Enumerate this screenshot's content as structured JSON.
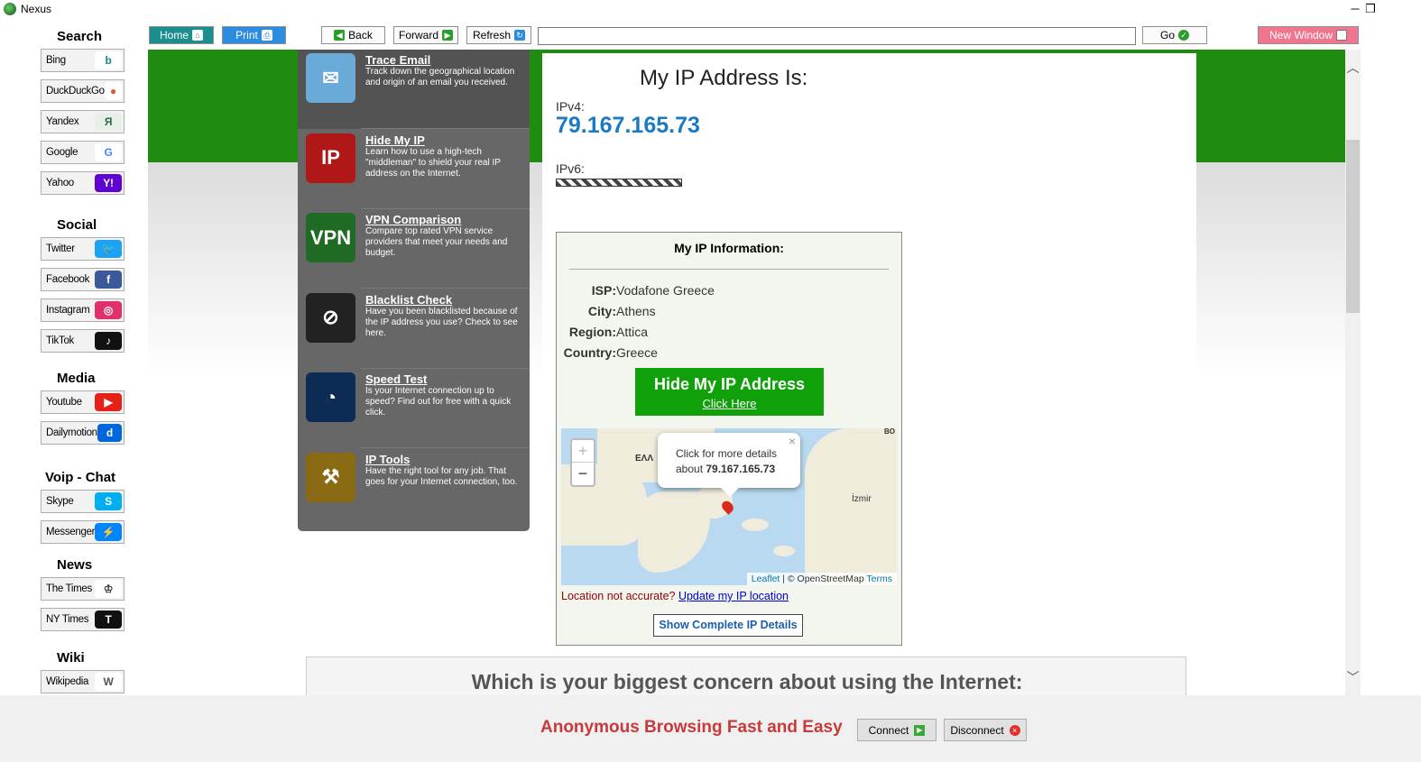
{
  "window": {
    "title": "Nexus",
    "restore_glyph": "❐"
  },
  "sidebar": {
    "categories": [
      {
        "title": "Search",
        "items": [
          {
            "label": "Bing",
            "icon": "bing-icon",
            "glyph": "b",
            "color": "#0e8a8a",
            "bg": "#ffffff"
          },
          {
            "label": "DuckDuckGo",
            "icon": "duckduckgo-icon",
            "glyph": "●",
            "color": "#de5833",
            "bg": "#ffffff"
          },
          {
            "label": "Yandex",
            "icon": "yandex-icon",
            "glyph": "Я",
            "color": "#2a6b4a",
            "bg": "#e8efe8"
          },
          {
            "label": "Google",
            "icon": "google-icon",
            "glyph": "G",
            "color": "#4285f4",
            "bg": "#ffffff"
          },
          {
            "label": "Yahoo",
            "icon": "yahoo-icon",
            "glyph": "Y!",
            "color": "#ffffff",
            "bg": "#5f01d1"
          }
        ]
      },
      {
        "title": "Social",
        "items": [
          {
            "label": "Twitter",
            "icon": "twitter-icon",
            "glyph": "🐦",
            "color": "#ffffff",
            "bg": "#1da1f2"
          },
          {
            "label": "Facebook",
            "icon": "facebook-icon",
            "glyph": "f",
            "color": "#ffffff",
            "bg": "#3b5998"
          },
          {
            "label": "Instagram",
            "icon": "instagram-icon",
            "glyph": "◎",
            "color": "#ffffff",
            "bg": "#e1306c"
          },
          {
            "label": "TikTok",
            "icon": "tiktok-icon",
            "glyph": "♪",
            "color": "#ffffff",
            "bg": "#111111"
          }
        ]
      },
      {
        "title": "Media",
        "items": [
          {
            "label": "Youtube",
            "icon": "youtube-icon",
            "glyph": "▶",
            "color": "#ffffff",
            "bg": "#e62117"
          },
          {
            "label": "Dailymotion",
            "icon": "dailymotion-icon",
            "glyph": "d",
            "color": "#ffffff",
            "bg": "#0066dc"
          }
        ]
      },
      {
        "title": "Voip - Chat",
        "items": [
          {
            "label": "Skype",
            "icon": "skype-icon",
            "glyph": "S",
            "color": "#ffffff",
            "bg": "#00aff0"
          },
          {
            "label": "Messenger",
            "icon": "messenger-icon",
            "glyph": "⚡",
            "color": "#ffffff",
            "bg": "#0084ff"
          }
        ]
      },
      {
        "title": "News",
        "items": [
          {
            "label": "The Times",
            "icon": "the-times-icon",
            "glyph": "♔",
            "color": "#333333",
            "bg": "#ffffff"
          },
          {
            "label": "NY Times",
            "icon": "ny-times-icon",
            "glyph": "T",
            "color": "#ffffff",
            "bg": "#111111"
          }
        ]
      },
      {
        "title": "Wiki",
        "items": [
          {
            "label": "Wikipedia",
            "icon": "wikipedia-icon",
            "glyph": "W",
            "color": "#555555",
            "bg": "#ffffff"
          }
        ]
      }
    ]
  },
  "toolbar": {
    "home_label": "Home",
    "print_label": "Print",
    "back_label": "Back",
    "forward_label": "Forward",
    "refresh_label": "Refresh",
    "url_value": "",
    "go_label": "Go",
    "new_window_label": "New Window"
  },
  "tools": [
    {
      "name": "Trace Email",
      "desc": "Track down the geographical location and origin of an email you received.",
      "icon": "trace-email-icon",
      "glyph": "✉",
      "bg": "#6aaad8"
    },
    {
      "name": "Hide My IP",
      "desc": "Learn how to use a high-tech \"middleman\" to shield your real IP address on the Internet.",
      "icon": "hide-my-ip-icon",
      "glyph": "IP",
      "bg": "#b01717"
    },
    {
      "name": "VPN Comparison",
      "desc": "Compare top rated VPN service providers that meet your needs and budget.",
      "icon": "vpn-comparison-icon",
      "glyph": "VPN",
      "bg": "#1f6b23"
    },
    {
      "name": "Blacklist Check",
      "desc": "Have you been blacklisted because of the IP address you use? Check to see here.",
      "icon": "blacklist-check-icon",
      "glyph": "⊘",
      "bg": "#222222"
    },
    {
      "name": "Speed Test",
      "desc": "Is your Internet connection up to speed? Find out for free with a quick click.",
      "icon": "speed-test-icon",
      "glyph": "◔",
      "bg": "#0d2c55"
    },
    {
      "name": "IP Tools",
      "desc": "Have the right tool for any job. That goes for your Internet connection, too.",
      "icon": "ip-tools-icon",
      "glyph": "⚒",
      "bg": "#8a6a12"
    }
  ],
  "ip": {
    "heading": "My IP Address Is:",
    "ipv4_label": "IPv4:",
    "ipv4_value": "79.167.165.73",
    "ipv6_label": "IPv6:"
  },
  "info": {
    "title": "My IP Information:",
    "rows": [
      {
        "key": "ISP:",
        "value": "Vodafone Greece"
      },
      {
        "key": "City:",
        "value": "Athens"
      },
      {
        "key": "Region:",
        "value": "Attica"
      },
      {
        "key": "Country:",
        "value": "Greece"
      }
    ],
    "hide_btn_title": "Hide My IP Address",
    "hide_btn_link": "Click Here",
    "map": {
      "zoom_in": "+",
      "zoom_out": "−",
      "popup_line1": "Click for more details",
      "popup_line2_prefix": "about ",
      "popup_ip": "79.167.165.73",
      "close": "×",
      "attr_leaflet": "Leaflet",
      "attr_osm": " | © OpenStreetMap ",
      "attr_terms": "Terms",
      "label_ellada": "ΕΛΛ",
      "label_izmir": "İzmir",
      "label_bo": "BO"
    },
    "location_question": "Location not accurate? ",
    "location_link": "Update my IP location",
    "details_btn": "Show Complete IP Details"
  },
  "poll": {
    "question": "Which is your biggest concern about using the Internet:"
  },
  "bottom": {
    "slogan": "Anonymous Browsing Fast and Easy",
    "connect_label": "Connect",
    "disconnect_label": "Disconnect"
  }
}
